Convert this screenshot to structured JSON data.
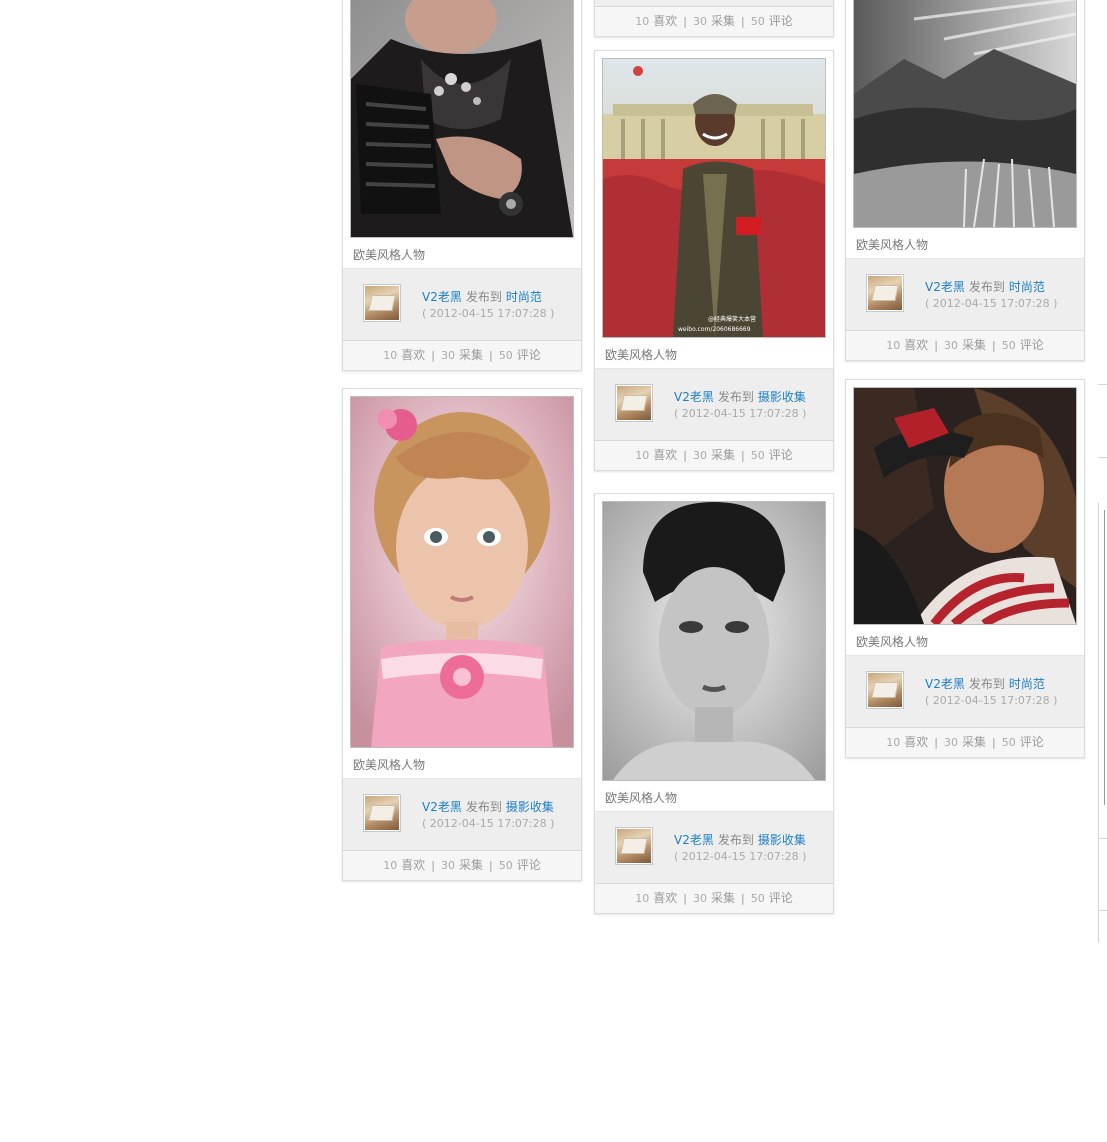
{
  "cards": [
    {
      "id": "c1",
      "caption": "欧美风格人物",
      "author": "V2老黑",
      "verb": "发布到",
      "board": "时尚范",
      "time": "( 2012-04-15 17:07:28 )",
      "likes": "10",
      "likes_label": "喜欢",
      "collects": "30",
      "collects_label": "采集",
      "comments": "50",
      "comments_label": "评论",
      "image_icon": "woman-lace-fashion-photo"
    },
    {
      "id": "c2",
      "caption": "欧美风格人物",
      "author": "V2老黑",
      "verb": "发布到",
      "board": "摄影收集",
      "time": "( 2012-04-15 17:07:28 )",
      "likes": "10",
      "likes_label": "喜欢",
      "collects": "30",
      "collects_label": "采集",
      "comments": "50",
      "comments_label": "评论",
      "image_icon": "girl-pink-dress-photo"
    },
    {
      "id": "c3",
      "stats_only": true,
      "likes": "10",
      "likes_label": "喜欢",
      "collects": "30",
      "collects_label": "采集",
      "comments": "50",
      "comments_label": "评论"
    },
    {
      "id": "c4",
      "caption": "欧美风格人物",
      "author": "V2老黑",
      "verb": "发布到",
      "board": "摄影收集",
      "time": "( 2012-04-15 17:07:28 )",
      "likes": "10",
      "likes_label": "喜欢",
      "collects": "30",
      "collects_label": "采集",
      "comments": "50",
      "comments_label": "评论",
      "image_icon": "man-red-armband-crowd-photo",
      "watermark_line1": "@经典爆笑大本营",
      "watermark_line2": "weibo.com/2060686669"
    },
    {
      "id": "c5",
      "caption": "欧美风格人物",
      "author": "V2老黑",
      "verb": "发布到",
      "board": "摄影收集",
      "time": "( 2012-04-15 17:07:28 )",
      "likes": "10",
      "likes_label": "喜欢",
      "collects": "30",
      "collects_label": "采集",
      "comments": "50",
      "comments_label": "评论",
      "image_icon": "woman-bw-portrait-photo"
    },
    {
      "id": "c6",
      "caption": "欧美风格人物",
      "author": "V2老黑",
      "verb": "发布到",
      "board": "时尚范",
      "time": "( 2012-04-15 17:07:28 )",
      "likes": "10",
      "likes_label": "喜欢",
      "collects": "30",
      "collects_label": "采集",
      "comments": "50",
      "comments_label": "评论",
      "image_icon": "mountain-landscape-photo"
    },
    {
      "id": "c7",
      "caption": "欧美风格人物",
      "author": "V2老黑",
      "verb": "发布到",
      "board": "时尚范",
      "time": "( 2012-04-15 17:07:28 )",
      "likes": "10",
      "likes_label": "喜欢",
      "collects": "30",
      "collects_label": "采集",
      "comments": "50",
      "comments_label": "评论",
      "image_icon": "man-scarf-portrait-photo"
    }
  ]
}
